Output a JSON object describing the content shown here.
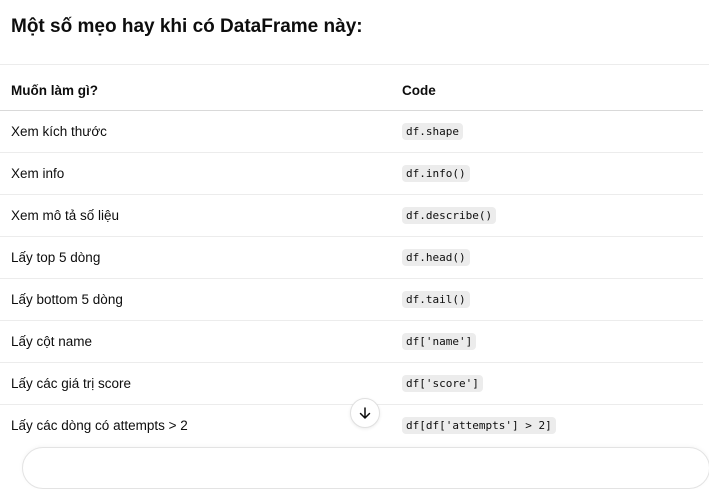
{
  "heading": "Một số mẹo hay khi có DataFrame này:",
  "table": {
    "headers": [
      "Muốn làm gì?",
      "Code"
    ],
    "rows": [
      {
        "action": "Xem kích thước",
        "code": "df.shape"
      },
      {
        "action": "Xem info",
        "code": "df.info()"
      },
      {
        "action": "Xem mô tả số liệu",
        "code": "df.describe()"
      },
      {
        "action": "Lấy top 5 dòng",
        "code": "df.head()"
      },
      {
        "action": "Lấy bottom 5 dòng",
        "code": "df.tail()"
      },
      {
        "action": "Lấy cột name",
        "code": "df['name']"
      },
      {
        "action": "Lấy các giá trị score",
        "code": "df['score']"
      },
      {
        "action": "Lấy các dòng có attempts > 2",
        "code": "df[df['attempts'] > 2]"
      }
    ]
  },
  "scroll_button": {
    "icon": "arrow-down-icon"
  }
}
